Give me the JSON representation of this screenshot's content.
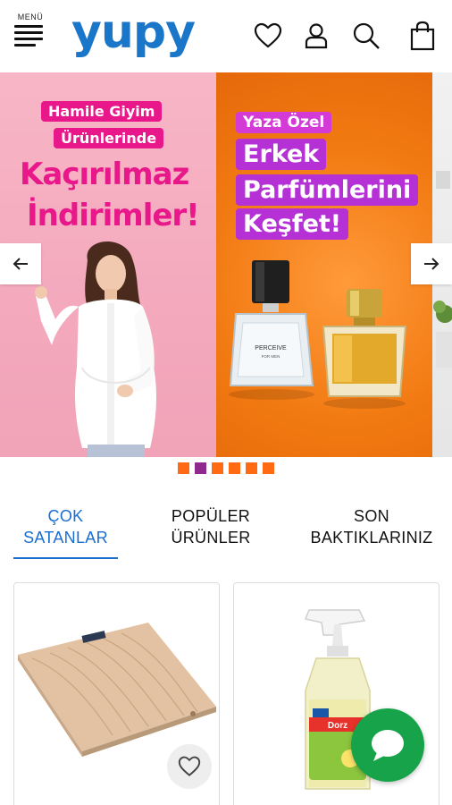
{
  "header": {
    "menu_label": "MENÜ",
    "logo_text": "yupy",
    "icons": [
      "heart-icon",
      "user-icon",
      "search-icon",
      "shopping-bag-icon"
    ],
    "brand_color": "#1a76c9"
  },
  "banner": {
    "slides": [
      {
        "tag_line1": "Hamile Giyim",
        "tag_line2": "Ürünlerinde",
        "headline1": "Kaçırılmaz",
        "headline2": "İndirimler!"
      },
      {
        "tag": "Yaza Özel",
        "headline1": "Erkek",
        "headline2": "Parfümlerini",
        "headline3": "Keşfet!",
        "bottle_label": "PERCEIVE",
        "bottle_sub": "FOR MEN"
      }
    ],
    "prev_icon": "arrow-left-icon",
    "next_icon": "arrow-right-icon",
    "dot_count": 6,
    "active_dot": 1,
    "dot_color": "#ff6a12",
    "active_dot_color": "#8e2a8e"
  },
  "tabs": [
    {
      "line1": "ÇOK",
      "line2": "SATANLAR",
      "active": true
    },
    {
      "line1": "POPÜLER",
      "line2": "ÜRÜNLER",
      "active": false
    },
    {
      "line1": "SON",
      "line2": "BAKTIKLARINIZ",
      "active": false
    }
  ],
  "products": [
    {
      "image": "digital-bathroom-scale",
      "fav_icon": "heart-icon"
    },
    {
      "image": "spray-cleaner-bottle",
      "fav_icon": "heart-icon"
    }
  ],
  "chat_button": {
    "icon": "chat-bubble-icon",
    "color": "#16a34a"
  }
}
